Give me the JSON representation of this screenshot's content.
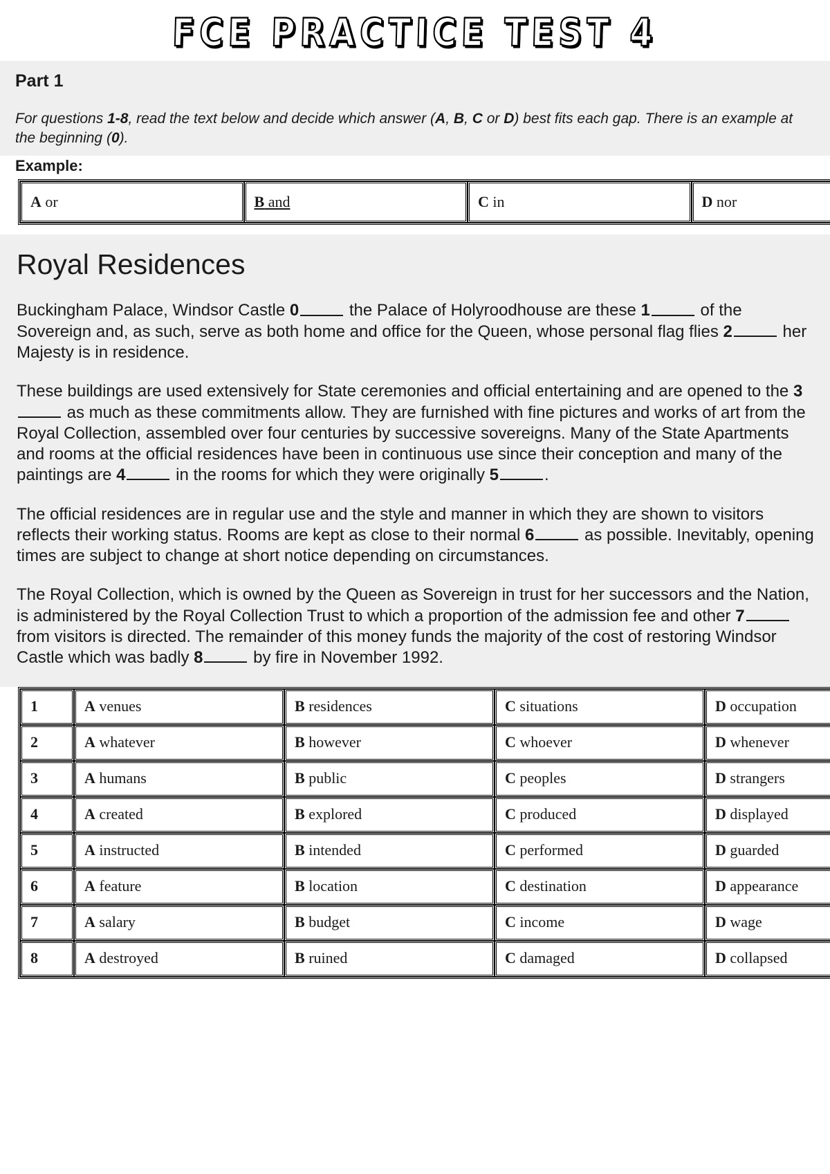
{
  "document": {
    "title": "FCE PRACTICE TEST 4"
  },
  "part": {
    "heading": "Part 1",
    "instructions_line1_prefix": "For questions ",
    "instructions_questions_range": "1-8",
    "instructions_line1_mid": ", read the text below and decide which answer (",
    "opt_a": "A",
    "sep1": ", ",
    "opt_b": "B",
    "sep2": ", ",
    "opt_c": "C",
    "sep3": " or ",
    "opt_d": "D",
    "instructions_line1_suffix": ") best fits each gap.",
    "instructions_line2_prefix": "There is an example at the beginning (",
    "instructions_example_num": "0",
    "instructions_line2_suffix": ").",
    "example_label": "Example:"
  },
  "example_row": {
    "options": [
      {
        "letter": "A",
        "text": "or",
        "correct": false
      },
      {
        "letter": "B",
        "text": "and",
        "correct": true
      },
      {
        "letter": "C",
        "text": "in",
        "correct": false
      },
      {
        "letter": "D",
        "text": "nor",
        "correct": false
      }
    ]
  },
  "passage": {
    "title": "Royal Residences",
    "paragraphs": [
      [
        {
          "t": "text",
          "v": "Buckingham Palace, Windsor Castle "
        },
        {
          "t": "num",
          "v": "0"
        },
        {
          "t": "gap"
        },
        {
          "t": "text",
          "v": " the Palace of Holyroodhouse are these "
        },
        {
          "t": "num",
          "v": "1"
        },
        {
          "t": "gap"
        },
        {
          "t": "text",
          "v": " of the Sovereign and, as such, serve as both home and office for the Queen, whose personal flag flies "
        },
        {
          "t": "num",
          "v": "2"
        },
        {
          "t": "gap"
        },
        {
          "t": "text",
          "v": " her Majesty is in residence."
        }
      ],
      [
        {
          "t": "text",
          "v": "These buildings are used extensively for State ceremonies and official entertaining and are opened to the "
        },
        {
          "t": "num",
          "v": "3"
        },
        {
          "t": "gap"
        },
        {
          "t": "text",
          "v": " as much as these commitments allow. They are furnished with fine pictures and works of art from the Royal Collection, assembled over four centuries by successive sovereigns. Many of the State Apartments and rooms at the official residences have been in continuous use since their conception and many of the paintings are "
        },
        {
          "t": "num",
          "v": "4"
        },
        {
          "t": "gap"
        },
        {
          "t": "text",
          "v": " in the rooms for which they were originally "
        },
        {
          "t": "num",
          "v": "5"
        },
        {
          "t": "gap"
        },
        {
          "t": "text",
          "v": "."
        }
      ],
      [
        {
          "t": "text",
          "v": "The official residences are in regular use and the style and manner in which they are shown to visitors reflects their working status. Rooms are kept as close to their normal "
        },
        {
          "t": "num",
          "v": "6"
        },
        {
          "t": "gap"
        },
        {
          "t": "text",
          "v": " as possible. Inevitably, opening times are subject to change at short notice depending on circumstances."
        }
      ],
      [
        {
          "t": "text",
          "v": "The Royal Collection, which is owned by the Queen as Sovereign in trust for her successors and the Nation, is administered by the Royal Collection Trust to which a proportion of the admission fee and other "
        },
        {
          "t": "num",
          "v": "7"
        },
        {
          "t": "gap"
        },
        {
          "t": "text",
          "v": " from visitors is directed. The remainder of this money funds the majority of the cost of restoring Windsor Castle which was badly "
        },
        {
          "t": "num",
          "v": "8"
        },
        {
          "t": "gap"
        },
        {
          "t": "text",
          "v": " by fire in November 1992."
        }
      ]
    ]
  },
  "questions": [
    {
      "number": "1",
      "options": [
        {
          "letter": "A",
          "text": "venues"
        },
        {
          "letter": "B",
          "text": "residences"
        },
        {
          "letter": "C",
          "text": "situations"
        },
        {
          "letter": "D",
          "text": "occupation"
        }
      ]
    },
    {
      "number": "2",
      "options": [
        {
          "letter": "A",
          "text": "whatever"
        },
        {
          "letter": "B",
          "text": "however"
        },
        {
          "letter": "C",
          "text": "whoever"
        },
        {
          "letter": "D",
          "text": "whenever"
        }
      ]
    },
    {
      "number": "3",
      "options": [
        {
          "letter": "A",
          "text": "humans"
        },
        {
          "letter": "B",
          "text": "public"
        },
        {
          "letter": "C",
          "text": "peoples"
        },
        {
          "letter": "D",
          "text": "strangers"
        }
      ]
    },
    {
      "number": "4",
      "options": [
        {
          "letter": "A",
          "text": "created"
        },
        {
          "letter": "B",
          "text": "explored"
        },
        {
          "letter": "C",
          "text": "produced"
        },
        {
          "letter": "D",
          "text": "displayed"
        }
      ]
    },
    {
      "number": "5",
      "options": [
        {
          "letter": "A",
          "text": "instructed"
        },
        {
          "letter": "B",
          "text": "intended"
        },
        {
          "letter": "C",
          "text": "performed"
        },
        {
          "letter": "D",
          "text": "guarded"
        }
      ]
    },
    {
      "number": "6",
      "options": [
        {
          "letter": "A",
          "text": "feature"
        },
        {
          "letter": "B",
          "text": "location"
        },
        {
          "letter": "C",
          "text": "destination"
        },
        {
          "letter": "D",
          "text": "appearance"
        }
      ]
    },
    {
      "number": "7",
      "options": [
        {
          "letter": "A",
          "text": "salary"
        },
        {
          "letter": "B",
          "text": "budget"
        },
        {
          "letter": "C",
          "text": "income"
        },
        {
          "letter": "D",
          "text": "wage"
        }
      ]
    },
    {
      "number": "8",
      "options": [
        {
          "letter": "A",
          "text": "destroyed"
        },
        {
          "letter": "B",
          "text": "ruined"
        },
        {
          "letter": "C",
          "text": "damaged"
        },
        {
          "letter": "D",
          "text": "collapsed"
        }
      ]
    }
  ]
}
